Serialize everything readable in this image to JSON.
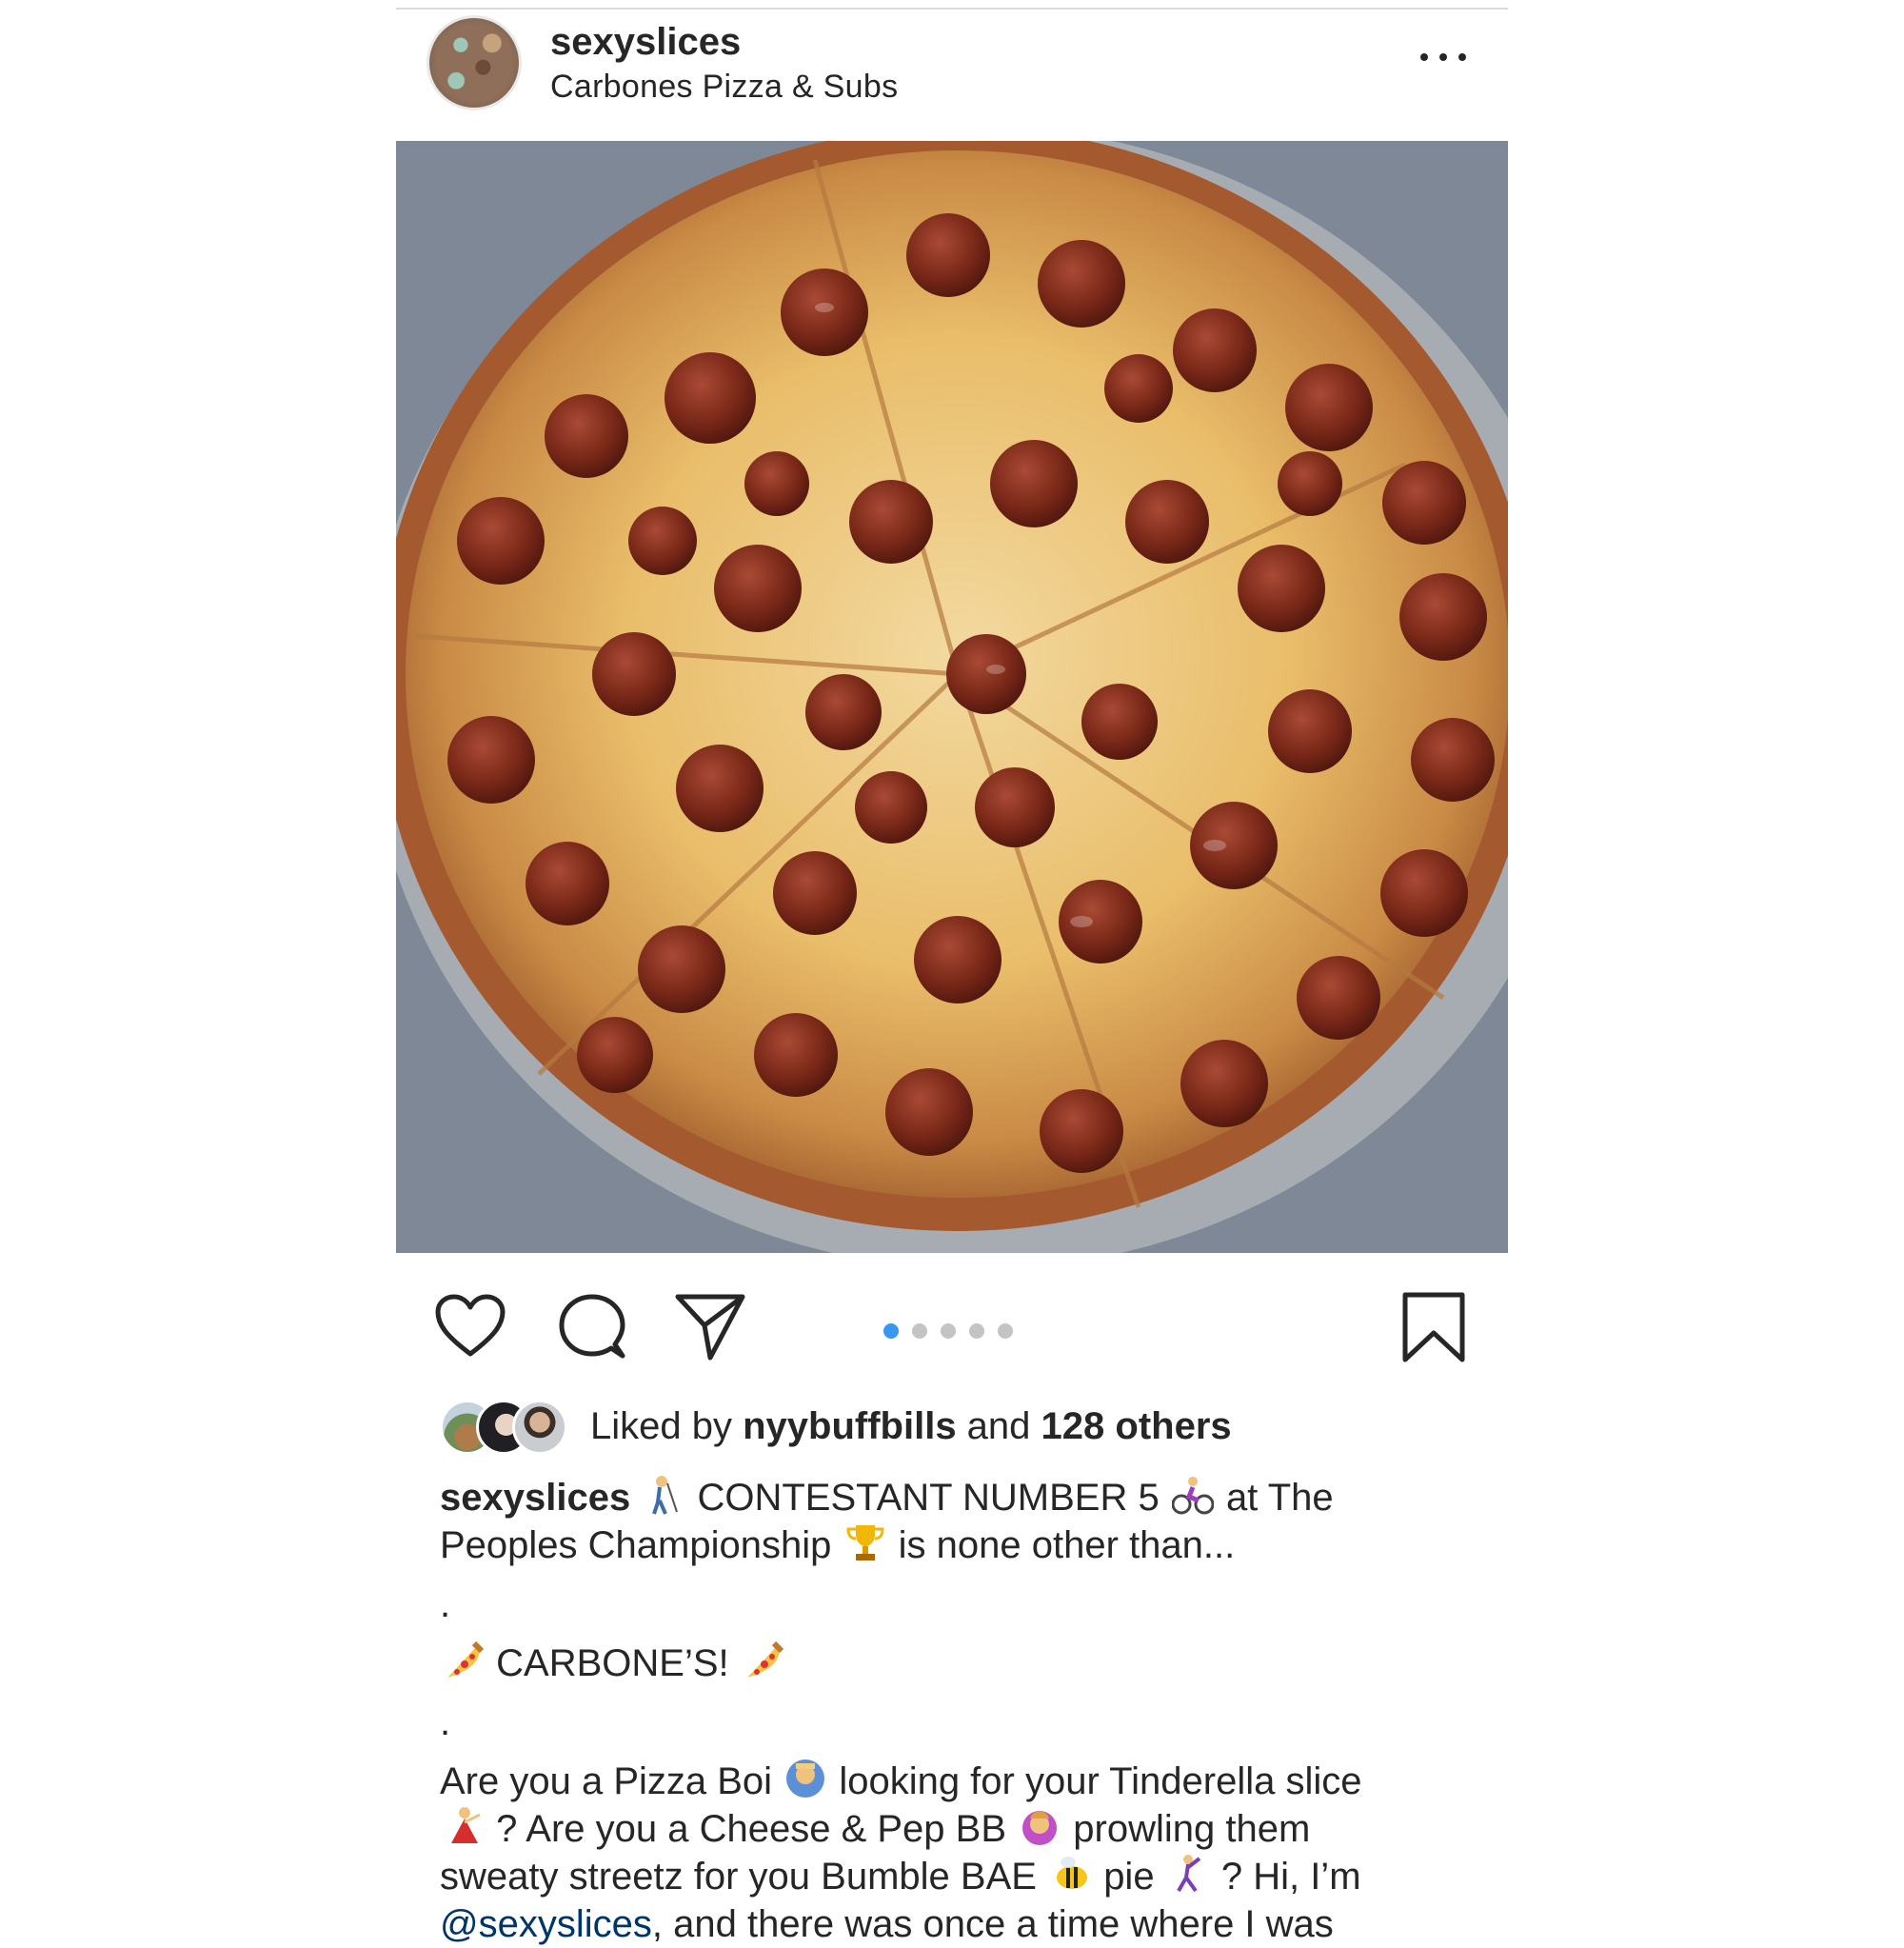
{
  "post": {
    "username": "sexyslices",
    "location": "Carbones Pizza & Subs",
    "more_icon": "ellipsis-icon",
    "carousel": {
      "count": 5,
      "active_index": 0,
      "active_color": "#3897f0"
    },
    "likes": {
      "prefix": "Liked by ",
      "user": "nyybuffbills",
      "middle": " and ",
      "others": "128 others"
    },
    "caption": {
      "username": "sexyslices",
      "line1": "CONTESTANT NUMBER 5",
      "line1b": "at The",
      "line2": "Peoples Championship",
      "line2b": "is none other than...",
      "dot1": ".",
      "headline": "CARBONE’S!",
      "dot2": ".",
      "p1a": "Are you a Pizza Boi",
      "p1b": "looking for your Tinderella slice",
      "p2a": "? Are you a Cheese & Pep BB",
      "p2b": "prowling them",
      "p3a": "sweaty streetz for you Bumble BAE",
      "p3b": "pie",
      "p3c": "? Hi, I’m",
      "p4mention": "@sexyslices",
      "p4rest": ", and there was once a time where I was"
    },
    "icons": {
      "like": "heart-icon",
      "comment": "comment-icon",
      "share": "paper-plane-icon",
      "save": "bookmark-icon"
    }
  }
}
